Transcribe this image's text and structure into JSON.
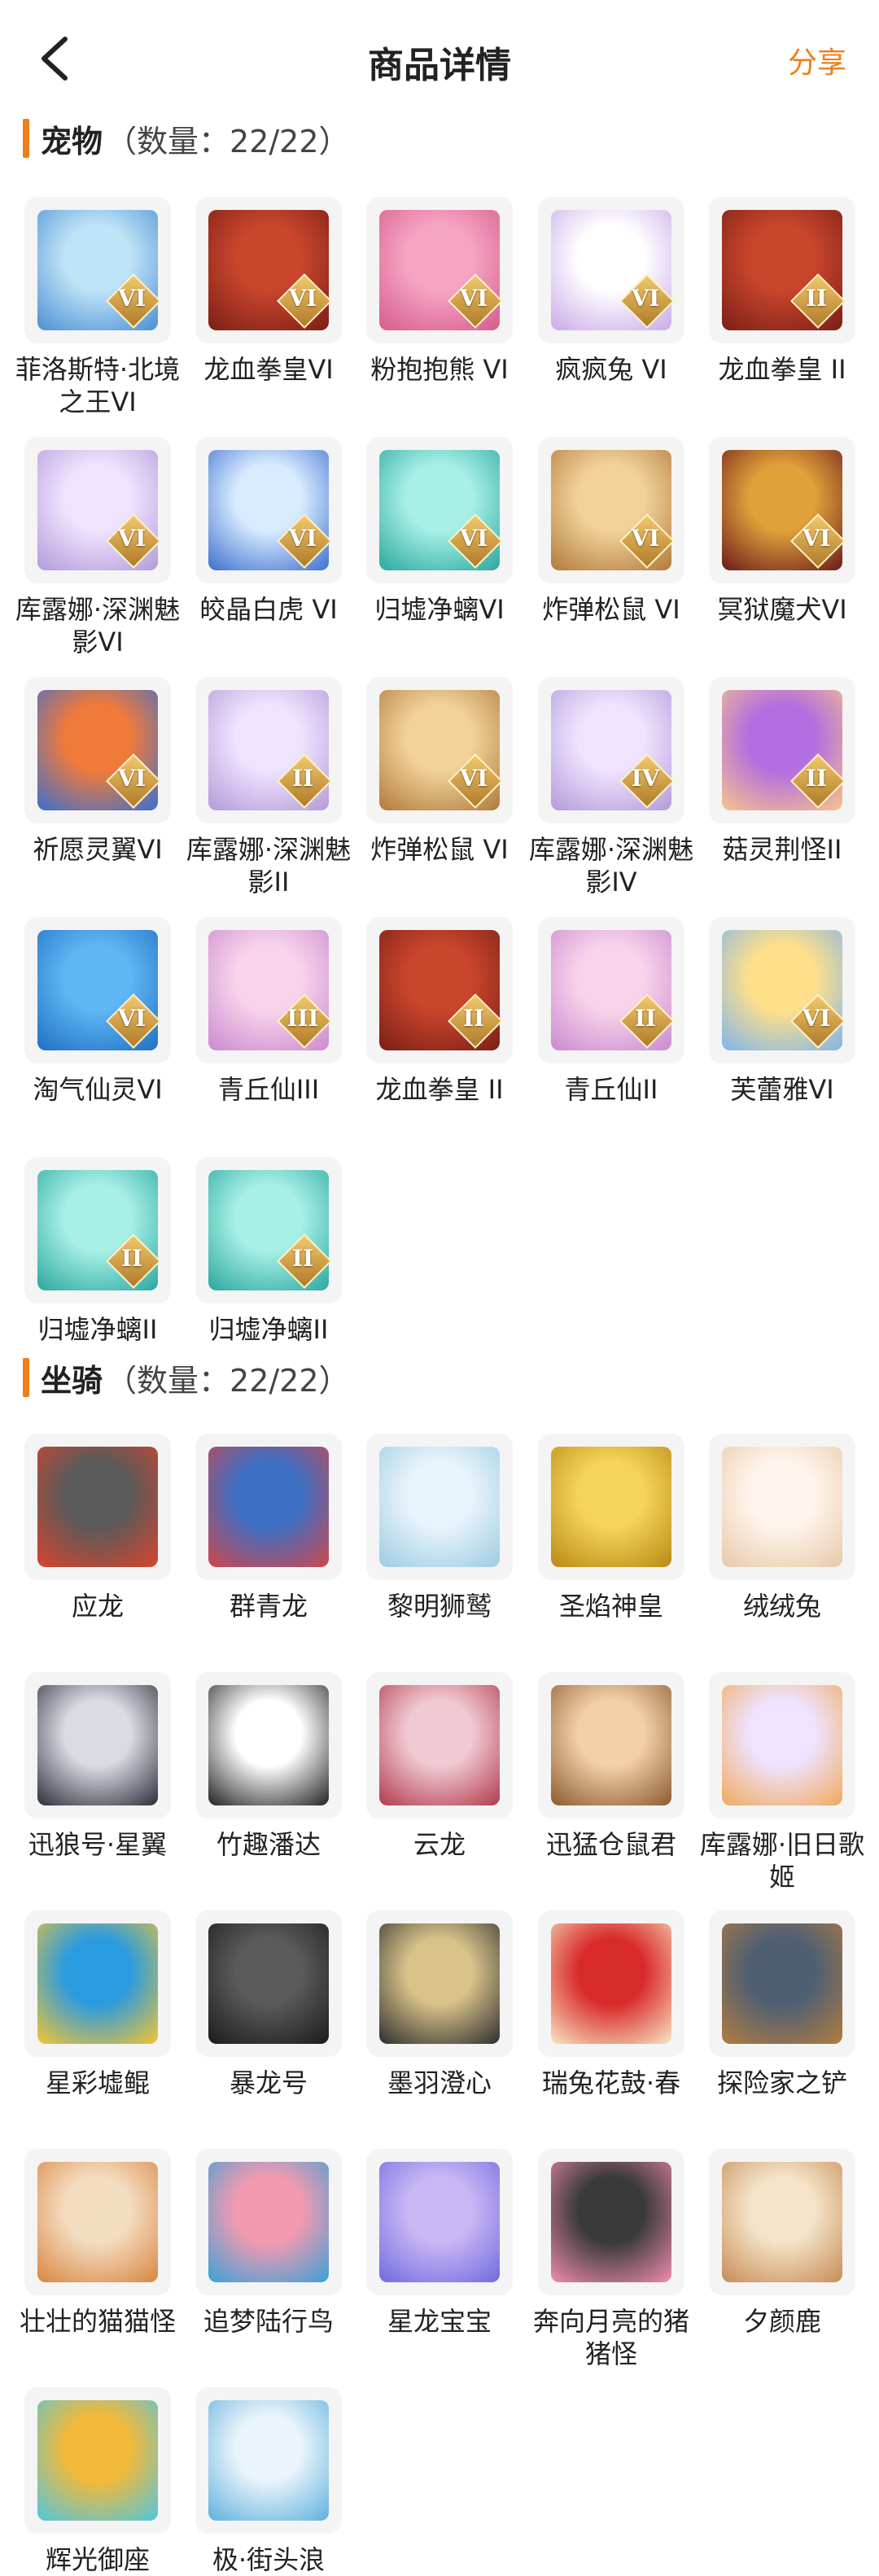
{
  "header": {
    "title": "商品详情",
    "share_label": "分享"
  },
  "colors": {
    "accent": "#f07d1a",
    "thumb_bg": "#f4f4f4"
  },
  "pets": {
    "title": "宠物",
    "count_label": "（数量：22/22）",
    "items": [
      {
        "name": "菲洛斯特·北境之王VI",
        "rank": "VI",
        "art": "ice-warrior",
        "tone": [
          "#bfe3f7",
          "#4a8fd3"
        ]
      },
      {
        "name": "龙血拳皇VI",
        "rank": "VI",
        "art": "dragon-boxer",
        "tone": [
          "#c9452c",
          "#7a1f16"
        ]
      },
      {
        "name": "粉抱抱熊 VI",
        "rank": "VI",
        "art": "pink-bear",
        "tone": [
          "#f6a4c4",
          "#d65b8d"
        ]
      },
      {
        "name": "疯疯兔 VI",
        "rank": "VI",
        "art": "crazy-rabbit",
        "tone": [
          "#ffffff",
          "#c9a9e8"
        ]
      },
      {
        "name": "龙血拳皇 II",
        "rank": "II",
        "art": "dragon-boxer",
        "tone": [
          "#c9452c",
          "#7a1f16"
        ]
      },
      {
        "name": "库露娜·深渊魅影VI",
        "rank": "VI",
        "art": "kuluna",
        "tone": [
          "#efe3ff",
          "#b39ad8"
        ]
      },
      {
        "name": "皎晶白虎 VI",
        "rank": "VI",
        "art": "white-tiger",
        "tone": [
          "#d9ecff",
          "#3c6fcf"
        ]
      },
      {
        "name": "归墟净螭VI",
        "rank": "VI",
        "art": "jade-dragon",
        "tone": [
          "#a8f0e6",
          "#2aa7a0"
        ]
      },
      {
        "name": "炸弹松鼠 VI",
        "rank": "VI",
        "art": "bomb-squirrel",
        "tone": [
          "#f2d29b",
          "#b07a3a"
        ]
      },
      {
        "name": "冥狱魔犬VI",
        "rank": "VI",
        "art": "hell-hound",
        "tone": [
          "#e0a13a",
          "#6b1a1a"
        ]
      },
      {
        "name": "祈愿灵翼VI",
        "rank": "VI",
        "art": "wish-wing",
        "tone": [
          "#f07a3a",
          "#3a6fd0"
        ]
      },
      {
        "name": "库露娜·深渊魅影II",
        "rank": "II",
        "art": "kuluna",
        "tone": [
          "#efe3ff",
          "#b39ad8"
        ]
      },
      {
        "name": "炸弹松鼠 VI",
        "rank": "VI",
        "art": "bomb-squirrel",
        "tone": [
          "#f2d29b",
          "#b07a3a"
        ]
      },
      {
        "name": "库露娜·深渊魅影IV",
        "rank": "IV",
        "art": "kuluna",
        "tone": [
          "#efe3ff",
          "#b39ad8"
        ]
      },
      {
        "name": "菇灵荆怪II",
        "rank": "II",
        "art": "mushroom-sprite",
        "tone": [
          "#b46de0",
          "#f7c58a"
        ]
      },
      {
        "name": "淘气仙灵VI",
        "rank": "VI",
        "art": "naughty-fairy",
        "tone": [
          "#5fb6f2",
          "#1f6fc4"
        ]
      },
      {
        "name": "青丘仙III",
        "rank": "III",
        "art": "qingqiu-fox",
        "tone": [
          "#f8d3ea",
          "#c98ad0"
        ]
      },
      {
        "name": "龙血拳皇 II",
        "rank": "II",
        "art": "dragon-boxer",
        "tone": [
          "#c9452c",
          "#7a1f16"
        ]
      },
      {
        "name": "青丘仙II",
        "rank": "II",
        "art": "qingqiu-fox",
        "tone": [
          "#f8d3ea",
          "#c98ad0"
        ]
      },
      {
        "name": "芙蕾雅VI",
        "rank": "VI",
        "art": "freya",
        "tone": [
          "#ffe08a",
          "#7fb4ec"
        ]
      },
      {
        "name": "归墟净螭II",
        "rank": "II",
        "art": "jade-dragon",
        "tone": [
          "#a8f0e6",
          "#2aa7a0"
        ]
      },
      {
        "name": "归墟净螭II",
        "rank": "II",
        "art": "jade-dragon",
        "tone": [
          "#a8f0e6",
          "#2aa7a0"
        ]
      }
    ]
  },
  "mounts": {
    "title": "坐骑",
    "count_label": "（数量：22/22）",
    "items": [
      {
        "name": "应龙",
        "art": "ying-dragon",
        "tone": [
          "#5a5a5a",
          "#d8442c"
        ]
      },
      {
        "name": "群青龙",
        "art": "azure-dragon",
        "tone": [
          "#3d6fc4",
          "#d0464a"
        ]
      },
      {
        "name": "黎明狮鹫",
        "art": "griffin",
        "tone": [
          "#e8f4fb",
          "#9ccbe3"
        ]
      },
      {
        "name": "圣焰神皇",
        "art": "golden-phoenix",
        "tone": [
          "#f6d35a",
          "#b78a14"
        ]
      },
      {
        "name": "绒绒兔",
        "art": "fluffy-rabbit",
        "tone": [
          "#fff5ec",
          "#e8c8a8"
        ]
      },
      {
        "name": "迅狼号·星翼",
        "art": "star-wolf",
        "tone": [
          "#d9dce3",
          "#2c2f3a"
        ]
      },
      {
        "name": "竹趣潘达",
        "art": "panda",
        "tone": [
          "#ffffff",
          "#222222"
        ]
      },
      {
        "name": "云龙",
        "art": "cloud-dragon",
        "tone": [
          "#f1c9d2",
          "#b2394d"
        ]
      },
      {
        "name": "迅猛仓鼠君",
        "art": "hamster",
        "tone": [
          "#f3d0a8",
          "#8c5a2e"
        ]
      },
      {
        "name": "库露娜·旧日歌姬",
        "art": "kuluna-singer",
        "tone": [
          "#efe3ff",
          "#f0a95a"
        ]
      },
      {
        "name": "星彩墟鲲",
        "art": "star-kun",
        "tone": [
          "#2b9be0",
          "#f4c531"
        ]
      },
      {
        "name": "暴龙号",
        "art": "tyrant-bike",
        "tone": [
          "#5a5a5a",
          "#1b1b1b"
        ]
      },
      {
        "name": "墨羽澄心",
        "art": "ink-staff",
        "tone": [
          "#d9c28a",
          "#2e2e2e"
        ]
      },
      {
        "name": "瑞兔花鼓·春",
        "art": "drum",
        "tone": [
          "#d92a2a",
          "#f7e6c2"
        ]
      },
      {
        "name": "探险家之铲",
        "art": "shovel",
        "tone": [
          "#4e5f73",
          "#b37c3f"
        ]
      },
      {
        "name": "壮壮的猫猫怪",
        "art": "cat-monster",
        "tone": [
          "#f4dcc0",
          "#d9853f"
        ]
      },
      {
        "name": "追梦陆行鸟",
        "art": "dream-bird",
        "tone": [
          "#f49ab0",
          "#39a1d8"
        ]
      },
      {
        "name": "星龙宝宝",
        "art": "baby-star-dragon",
        "tone": [
          "#c9b6f4",
          "#6f6be0"
        ]
      },
      {
        "name": "奔向月亮的猪猪怪",
        "art": "pig-monster",
        "tone": [
          "#3a3a3a",
          "#f08cb0"
        ]
      },
      {
        "name": "夕颜鹿",
        "art": "dusk-deer",
        "tone": [
          "#f4e3c8",
          "#c78c56"
        ]
      },
      {
        "name": "辉光御座",
        "art": "radiant-throne",
        "tone": [
          "#f2b93a",
          "#4fc6e0"
        ]
      },
      {
        "name": "极·街头浪",
        "art": "street-board",
        "tone": [
          "#e9f4fb",
          "#5fb0de"
        ]
      }
    ]
  }
}
